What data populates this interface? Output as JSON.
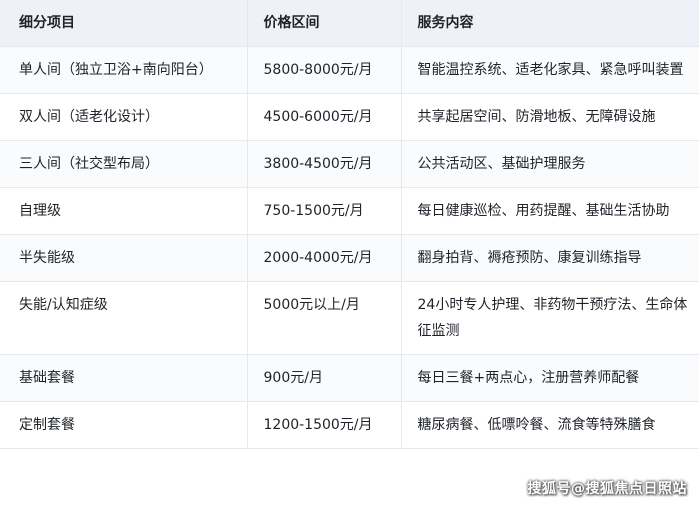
{
  "table": {
    "headers": [
      "细分项目",
      "价格区间",
      "服务内容"
    ],
    "rows": [
      {
        "item": "单人间（独立卫浴+南向阳台）",
        "price": "5800-8000元/月",
        "service": "智能温控系统、适老化家具、紧急呼叫装置"
      },
      {
        "item": "双人间（适老化设计）",
        "price": "4500-6000元/月",
        "service": "共享起居空间、防滑地板、无障碍设施"
      },
      {
        "item": "三人间（社交型布局）",
        "price": "3800-4500元/月",
        "service": "公共活动区、基础护理服务"
      },
      {
        "item": "自理级",
        "price": "750-1500元/月",
        "service": "每日健康巡检、用药提醒、基础生活协助"
      },
      {
        "item": "半失能级",
        "price": "2000-4000元/月",
        "service": "翻身拍背、褥疮预防、康复训练指导"
      },
      {
        "item": "失能/认知症级",
        "price": "5000元以上/月",
        "service": "24小时专人护理、非药物干预疗法、生命体征监测"
      },
      {
        "item": "基础套餐",
        "price": "900元/月",
        "service": "每日三餐+两点心，注册营养师配餐"
      },
      {
        "item": "定制套餐",
        "price": "1200-1500元/月",
        "service": "糖尿病餐、低嘌呤餐、流食等特殊膳食"
      }
    ]
  },
  "watermark": "搜狐号@搜狐焦点日照站"
}
